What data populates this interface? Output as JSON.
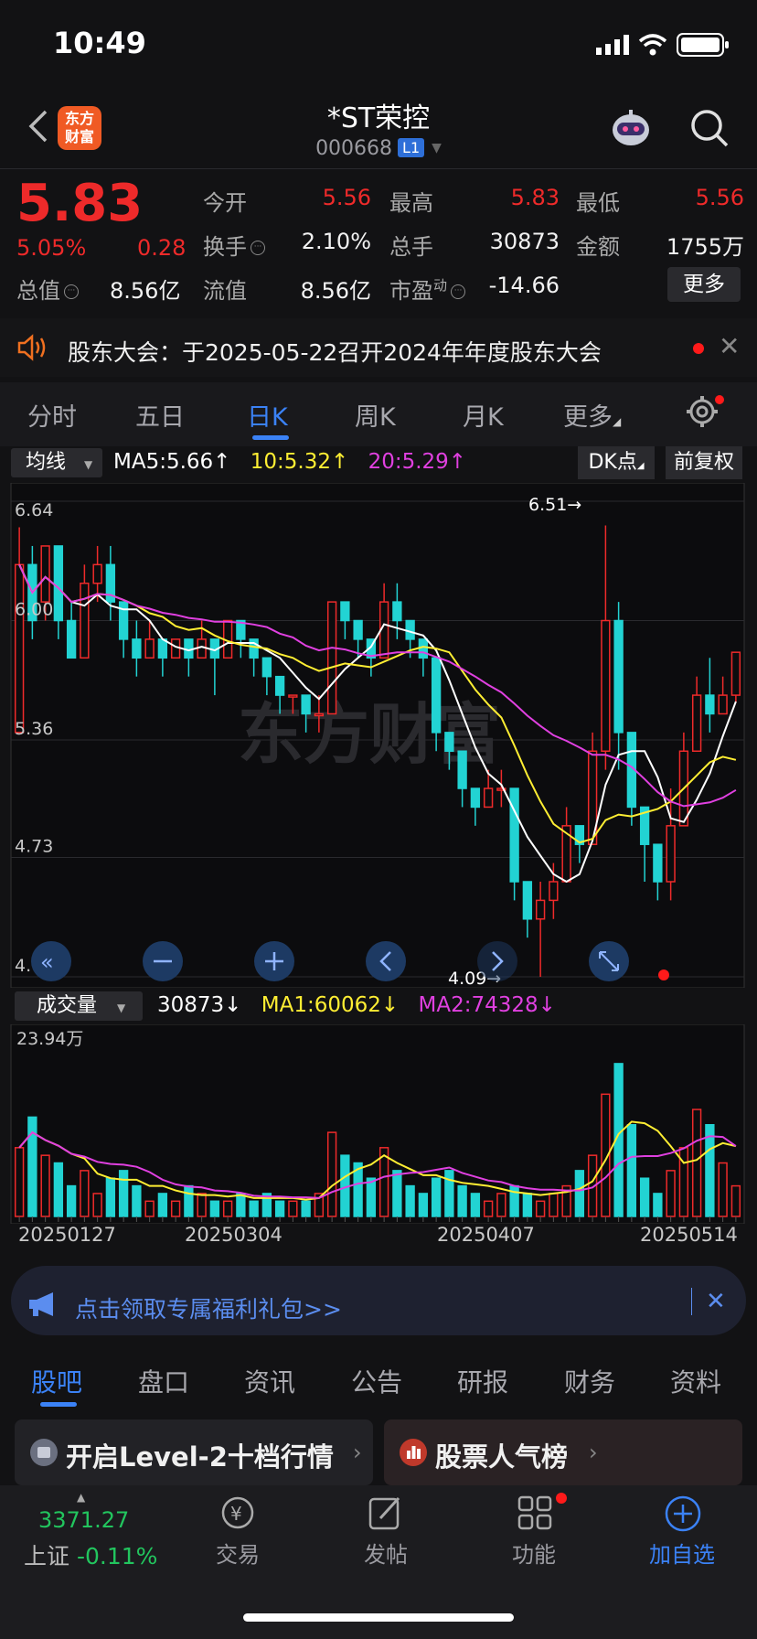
{
  "status_bar": {
    "time": "10:49"
  },
  "header": {
    "title": "*ST荣控",
    "code": "000668",
    "level_badge": "L1",
    "logo_text_line1": "东方",
    "logo_text_line2": "财富"
  },
  "quote": {
    "price": "5.83",
    "change_pct": "5.05%",
    "change": "0.28",
    "total_value_label": "总值",
    "total_value": "8.56亿",
    "open_label": "今开",
    "open": "5.56",
    "high_label": "最高",
    "high": "5.83",
    "low_label": "最低",
    "low": "5.56",
    "turnover_label": "换手",
    "turnover": "2.10%",
    "volume_label": "总手",
    "volume": "30873",
    "amount_label": "金额",
    "amount": "1755万",
    "float_value_label": "流值",
    "float_value": "8.56亿",
    "pe_label": "市盈",
    "pe_sup": "动",
    "pe": "-14.66",
    "more_label": "更多"
  },
  "notice": {
    "text": "股东大会：于2025-05-22召开2024年年度股东大会"
  },
  "period_tabs": [
    "分时",
    "五日",
    "日K",
    "周K",
    "月K",
    "更多"
  ],
  "ma_legend": {
    "dropdown": "均线",
    "ma5": "MA5:5.66↑",
    "ma10": "10:5.32↑",
    "ma20": "20:5.29↑",
    "dk_label": "DK点",
    "adjust_label": "前复权"
  },
  "volume_legend": {
    "dropdown": "成交量",
    "vol": "30873↓",
    "ma1": "MA1:60062↓",
    "ma2": "MA2:74328↓",
    "max_label": "23.94万"
  },
  "colors": {
    "up": "#ee2a2a",
    "down": "#22d3d3",
    "ma5": "#ffffff",
    "ma10": "#ffee33",
    "ma20": "#e040e0",
    "accent": "#3b82f6"
  },
  "chart_data": {
    "type": "candlestick",
    "y_ticks": [
      "6.64",
      "6.00",
      "5.36",
      "4.73",
      "4.09"
    ],
    "ylim": [
      4.09,
      6.64
    ],
    "annotations": {
      "max": "6.51→",
      "min": "4.09→"
    },
    "x_labels": [
      "20250127",
      "20250304",
      "20250407",
      "20250514"
    ],
    "candles": [
      [
        5.4,
        6.3,
        6.5,
        5.4
      ],
      [
        6.3,
        6.0,
        6.4,
        5.9
      ],
      [
        6.1,
        6.4,
        6.4,
        6.0
      ],
      [
        6.4,
        6.0,
        6.4,
        5.9
      ],
      [
        6.0,
        5.8,
        6.1,
        5.8
      ],
      [
        5.8,
        6.2,
        6.3,
        5.8
      ],
      [
        6.2,
        6.3,
        6.4,
        6.1
      ],
      [
        6.3,
        6.1,
        6.4,
        6.0
      ],
      [
        6.1,
        5.9,
        6.1,
        5.8
      ],
      [
        5.9,
        5.8,
        6.0,
        5.7
      ],
      [
        5.8,
        5.9,
        6.0,
        5.8
      ],
      [
        5.9,
        5.8,
        5.9,
        5.7
      ],
      [
        5.8,
        5.9,
        5.9,
        5.8
      ],
      [
        5.9,
        5.8,
        5.9,
        5.7
      ],
      [
        5.8,
        5.9,
        6.0,
        5.8
      ],
      [
        5.9,
        5.8,
        5.9,
        5.6
      ],
      [
        5.8,
        6.0,
        6.0,
        5.8
      ],
      [
        6.0,
        5.9,
        6.0,
        5.8
      ],
      [
        5.9,
        5.8,
        5.9,
        5.7
      ],
      [
        5.8,
        5.7,
        5.8,
        5.6
      ],
      [
        5.7,
        5.6,
        5.7,
        5.5
      ],
      [
        5.6,
        5.6,
        5.6,
        5.5
      ],
      [
        5.6,
        5.5,
        5.6,
        5.4
      ],
      [
        5.5,
        5.5,
        5.6,
        5.4
      ],
      [
        5.5,
        6.1,
        6.1,
        5.5
      ],
      [
        6.1,
        6.0,
        6.1,
        5.9
      ],
      [
        6.0,
        5.9,
        6.0,
        5.8
      ],
      [
        5.9,
        5.8,
        5.9,
        5.7
      ],
      [
        5.8,
        6.1,
        6.2,
        5.8
      ],
      [
        6.1,
        6.0,
        6.2,
        5.9
      ],
      [
        6.0,
        5.9,
        6.0,
        5.8
      ],
      [
        5.9,
        5.8,
        5.9,
        5.7
      ],
      [
        5.8,
        5.4,
        5.8,
        5.3
      ],
      [
        5.4,
        5.3,
        5.4,
        5.2
      ],
      [
        5.3,
        5.1,
        5.3,
        5.0
      ],
      [
        5.1,
        5.0,
        5.1,
        4.9
      ],
      [
        5.0,
        5.1,
        5.2,
        5.0
      ],
      [
        5.1,
        5.1,
        5.2,
        5.0
      ],
      [
        5.1,
        4.6,
        5.1,
        4.5
      ],
      [
        4.6,
        4.4,
        4.6,
        4.3
      ],
      [
        4.4,
        4.5,
        4.6,
        4.09
      ],
      [
        4.5,
        4.6,
        4.7,
        4.4
      ],
      [
        4.6,
        4.9,
        5.0,
        4.6
      ],
      [
        4.9,
        4.8,
        4.9,
        4.7
      ],
      [
        4.8,
        5.3,
        5.4,
        4.8
      ],
      [
        5.3,
        6.0,
        6.51,
        5.2
      ],
      [
        6.0,
        5.4,
        6.1,
        5.2
      ],
      [
        5.4,
        5.0,
        5.4,
        4.9
      ],
      [
        5.0,
        4.8,
        5.0,
        4.6
      ],
      [
        4.8,
        4.6,
        4.8,
        4.5
      ],
      [
        4.6,
        4.9,
        5.1,
        4.5
      ],
      [
        4.9,
        5.3,
        5.4,
        4.9
      ],
      [
        5.3,
        5.6,
        5.7,
        5.3
      ],
      [
        5.6,
        5.5,
        5.8,
        5.4
      ],
      [
        5.5,
        5.6,
        5.7,
        5.5
      ],
      [
        5.6,
        5.83,
        5.83,
        5.56
      ]
    ],
    "volume": [
      9,
      13,
      8,
      7,
      4,
      6,
      3,
      5,
      6,
      4,
      2,
      3,
      2,
      4,
      3,
      2,
      2,
      3,
      2,
      3,
      2,
      2,
      2,
      3,
      11,
      8,
      7,
      5,
      9,
      6,
      4,
      3,
      5,
      6,
      4,
      3,
      2,
      3,
      4,
      3,
      2,
      3,
      4,
      6,
      8,
      16,
      20,
      12,
      5,
      3,
      6,
      9,
      14,
      12,
      7,
      4
    ],
    "volume_max": 23.94
  },
  "promo": {
    "text": "点击领取专属福利礼包>>"
  },
  "bottom_tabs": [
    "股吧",
    "盘口",
    "资讯",
    "公告",
    "研报",
    "财务",
    "资料"
  ],
  "cards": {
    "left_title": "开启Level-2十档行情",
    "right_title": "股票人气榜"
  },
  "bottom_nav": {
    "index_value": "3371.27",
    "index_name": "上证",
    "index_change": "-0.11%",
    "trade": "交易",
    "post": "发帖",
    "features": "功能",
    "add": "加自选"
  }
}
